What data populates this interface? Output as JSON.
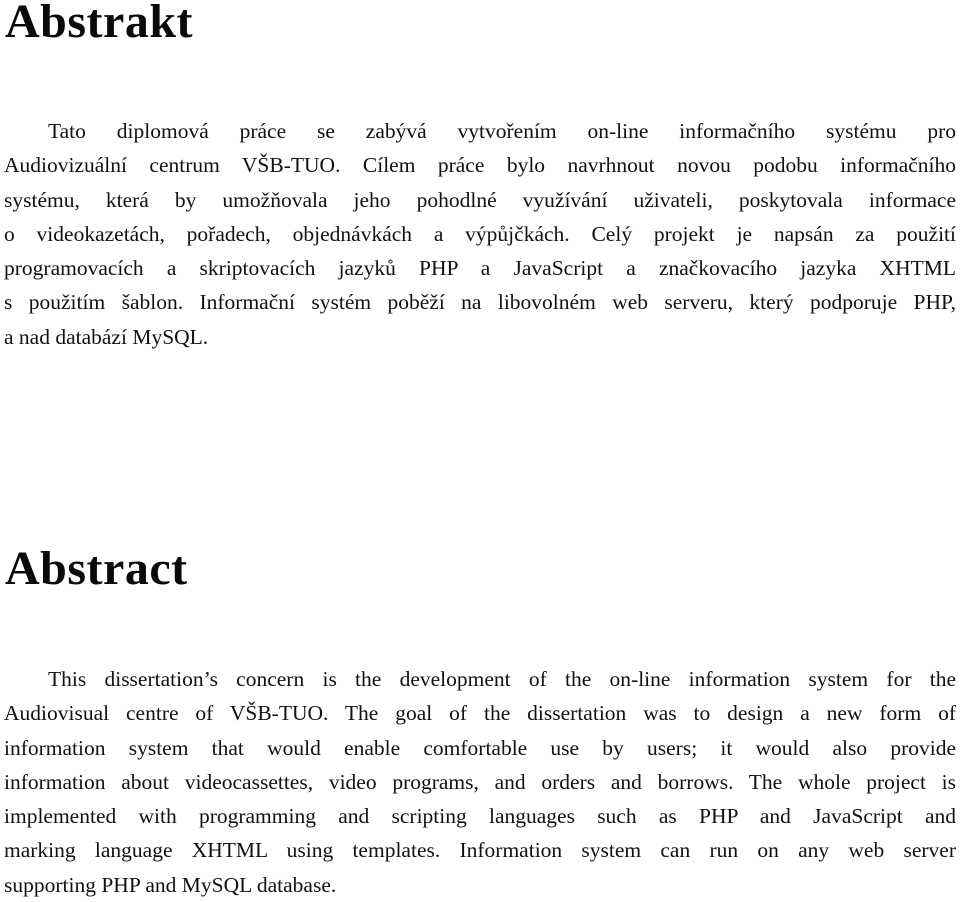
{
  "czech_abstract": {
    "heading": "Abstrakt",
    "lines": [
      "Tato diplomová práce se zabývá vytvořením on-line informačního systému pro",
      "Audiovizuální centrum VŠB-TUO. Cílem práce bylo navrhnout novou podobu informačního",
      "systému, která by umožňovala jeho pohodlné využívání uživateli, poskytovala informace",
      "o videokazetách, pořadech, objednávkách a výpůjčkách. Celý projekt je napsán za použití",
      "programovacích a skriptovacích jazyků PHP a JavaScript a značkovacího jazyka XHTML",
      "s použitím šablon. Informační systém poběží na libovolném web serveru, který podporuje PHP,",
      "a nad databází MySQL."
    ]
  },
  "english_abstract": {
    "heading": "Abstract",
    "lines": [
      "This dissertation’s concern is the development of the on-line information system for the",
      "Audiovisual centre of VŠB-TUO. The goal of the dissertation was to design a new form of",
      "information system that would enable comfortable use by users; it would also provide",
      "information about videocassettes, video programs, and orders and borrows. The whole project is",
      "implemented with programming and scripting languages such as PHP and JavaScript and",
      "marking language XHTML using templates. Information system can run on any web server",
      "supporting PHP and MySQL database."
    ]
  }
}
